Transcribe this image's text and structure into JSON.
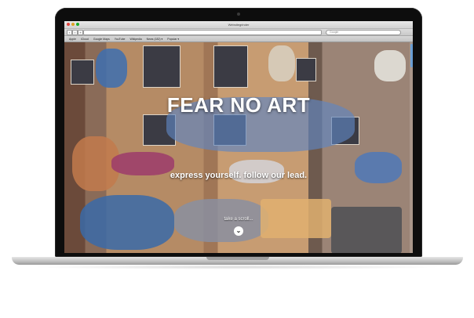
{
  "browser": {
    "window_title": "Websitegrinder",
    "bookmarks": [
      "Apple",
      "iCloud",
      "Google Maps",
      "YouTube",
      "Wikipedia",
      "News (182) ▾",
      "Popular ▾"
    ],
    "search_placeholder": "Google"
  },
  "hero": {
    "headline": "FEAR NO ART",
    "tagline": "express yourself. follow our lead.",
    "scroll_label": "take a scroll..."
  },
  "icons": {
    "scroll": "chevron-down-icon"
  },
  "colors": {
    "headline": "#ffffff",
    "scroll_thumb": "#6a9fd5"
  }
}
